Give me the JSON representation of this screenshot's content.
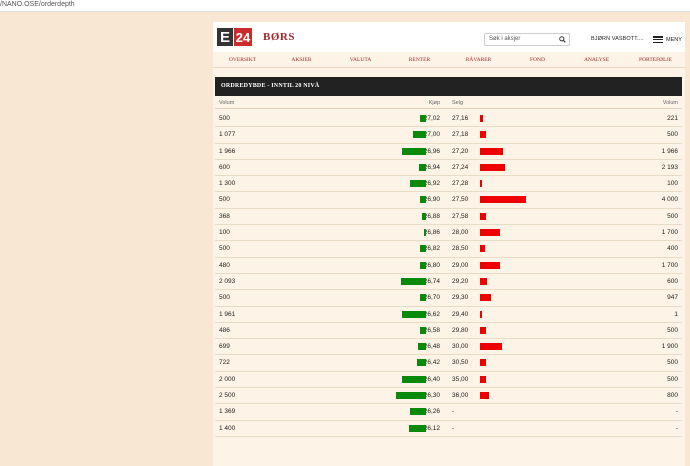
{
  "browser": {
    "url": "/NANO.OSE/orderdepth"
  },
  "site": {
    "logo_e": "E",
    "logo_24": "24",
    "brand": "BØRS",
    "search_placeholder": "Søk i aksjer",
    "user": "BJØRN VASBOTT....",
    "menu_label": "MENY"
  },
  "nav": [
    "OVERSIKT",
    "AKSJER",
    "VALUTA",
    "RENTER",
    "RÅVARER",
    "FOND",
    "ANALYSE",
    "PORTEFØLJE"
  ],
  "orderbook": {
    "title": "ORDREDYBDE - INNTIL 20 NIVÅ",
    "headers": {
      "buy_volume": "Volum",
      "buy_price": "Kjøp",
      "sell_price": "Selg",
      "sell_volume": "Volum"
    },
    "rows": [
      {
        "bvol": "500",
        "bprice": "27,02",
        "sprice": "27,16",
        "svol": "221",
        "b": 500,
        "s": 221
      },
      {
        "bvol": "1 077",
        "bprice": "27,00",
        "sprice": "27,18",
        "svol": "500",
        "b": 1077,
        "s": 500
      },
      {
        "bvol": "1 966",
        "bprice": "26,96",
        "sprice": "27,20",
        "svol": "1 966",
        "b": 1966,
        "s": 1966
      },
      {
        "bvol": "600",
        "bprice": "26,94",
        "sprice": "27,24",
        "svol": "2 193",
        "b": 600,
        "s": 2193
      },
      {
        "bvol": "1 300",
        "bprice": "26,92",
        "sprice": "27,28",
        "svol": "100",
        "b": 1300,
        "s": 100
      },
      {
        "bvol": "500",
        "bprice": "26,90",
        "sprice": "27,50",
        "svol": "4 000",
        "b": 500,
        "s": 4000
      },
      {
        "bvol": "368",
        "bprice": "26,88",
        "sprice": "27,58",
        "svol": "500",
        "b": 368,
        "s": 500
      },
      {
        "bvol": "100",
        "bprice": "26,86",
        "sprice": "28,00",
        "svol": "1 700",
        "b": 100,
        "s": 1700
      },
      {
        "bvol": "500",
        "bprice": "26,82",
        "sprice": "28,50",
        "svol": "400",
        "b": 500,
        "s": 400
      },
      {
        "bvol": "480",
        "bprice": "26,80",
        "sprice": "29,00",
        "svol": "1 700",
        "b": 480,
        "s": 1700
      },
      {
        "bvol": "2 093",
        "bprice": "26,74",
        "sprice": "29,20",
        "svol": "600",
        "b": 2093,
        "s": 600
      },
      {
        "bvol": "500",
        "bprice": "26,70",
        "sprice": "29,30",
        "svol": "947",
        "b": 500,
        "s": 947
      },
      {
        "bvol": "1 961",
        "bprice": "26,62",
        "sprice": "29,40",
        "svol": "1",
        "b": 1961,
        "s": 1
      },
      {
        "bvol": "486",
        "bprice": "26,58",
        "sprice": "29,80",
        "svol": "500",
        "b": 486,
        "s": 500
      },
      {
        "bvol": "699",
        "bprice": "26,48",
        "sprice": "30,00",
        "svol": "1 900",
        "b": 699,
        "s": 1900
      },
      {
        "bvol": "722",
        "bprice": "26,42",
        "sprice": "30,50",
        "svol": "500",
        "b": 722,
        "s": 500
      },
      {
        "bvol": "2 000",
        "bprice": "26,40",
        "sprice": "35,00",
        "svol": "500",
        "b": 2000,
        "s": 500
      },
      {
        "bvol": "2 500",
        "bprice": "26,30",
        "sprice": "36,00",
        "svol": "800",
        "b": 2500,
        "s": 800
      },
      {
        "bvol": "1 369",
        "bprice": "26,26",
        "sprice": "-",
        "svol": "-",
        "b": 1369,
        "s": 0
      },
      {
        "bvol": "1 400",
        "bprice": "26,12",
        "sprice": "-",
        "svol": "-",
        "b": 1400,
        "s": 0
      }
    ]
  },
  "colors": {
    "buy": "#0a8a0a",
    "sell": "#ee0000",
    "brand": "#a3262a"
  }
}
